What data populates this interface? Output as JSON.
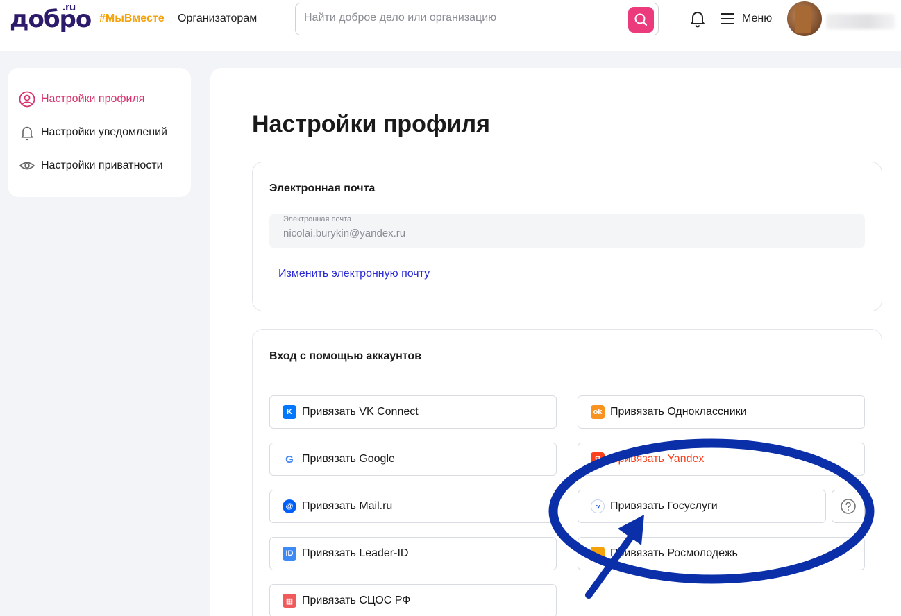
{
  "header": {
    "logo_text": "добро",
    "logo_suffix": ".ru",
    "nav_tag": "#МыВместе",
    "nav_organizers": "Организаторам",
    "search_placeholder": "Найти доброе дело или организацию",
    "menu_label": "Меню"
  },
  "sidebar": {
    "items": [
      {
        "label": "Настройки профиля",
        "icon": "user-circle-icon",
        "active": true
      },
      {
        "label": "Настройки уведомлений",
        "icon": "bell-icon",
        "active": false
      },
      {
        "label": "Настройки приватности",
        "icon": "eye-icon",
        "active": false
      }
    ]
  },
  "main": {
    "title": "Настройки профиля",
    "email_section": {
      "title": "Электронная почта",
      "field_label": "Электронная почта",
      "field_value": "nicolai.burykin@yandex.ru",
      "change_link": "Изменить электронную почту"
    },
    "accounts_section": {
      "title": "Вход с помощью аккаунтов",
      "buttons": [
        {
          "label": "Привязать VK Connect",
          "icon": "vk-icon",
          "color": "#0077ff"
        },
        {
          "label": "Привязать Одноклассники",
          "icon": "odnoklassniki-icon",
          "color": "#f7931e"
        },
        {
          "label": "Привязать Google",
          "icon": "google-icon",
          "color": "#4285f4"
        },
        {
          "label": "Привязать Yandex",
          "icon": "yandex-icon",
          "color": "#fc3f1d"
        },
        {
          "label": "Привязать Mail.ru",
          "icon": "mailru-icon",
          "color": "#005ff9"
        },
        {
          "label": "Привязать Госуслуги",
          "icon": "gosuslugi-icon",
          "color": "#0d4cd3"
        },
        {
          "label": "Привязать Leader-ID",
          "icon": "leader-id-icon",
          "color": "#3d8af7"
        },
        {
          "label": "Привязать Росмолодежь",
          "icon": "rosmolodezh-icon",
          "color": "#f5a20a"
        },
        {
          "label": "Привязать СЦОС РФ",
          "icon": "scos-icon",
          "color": "#f05a5a"
        }
      ]
    }
  },
  "colors": {
    "accent_pink": "#ec3b7c",
    "active_link": "#d6336c",
    "tag_orange": "#f5a20a",
    "link_blue": "#2a2ad6",
    "annotation_blue": "#0a2fa8"
  }
}
